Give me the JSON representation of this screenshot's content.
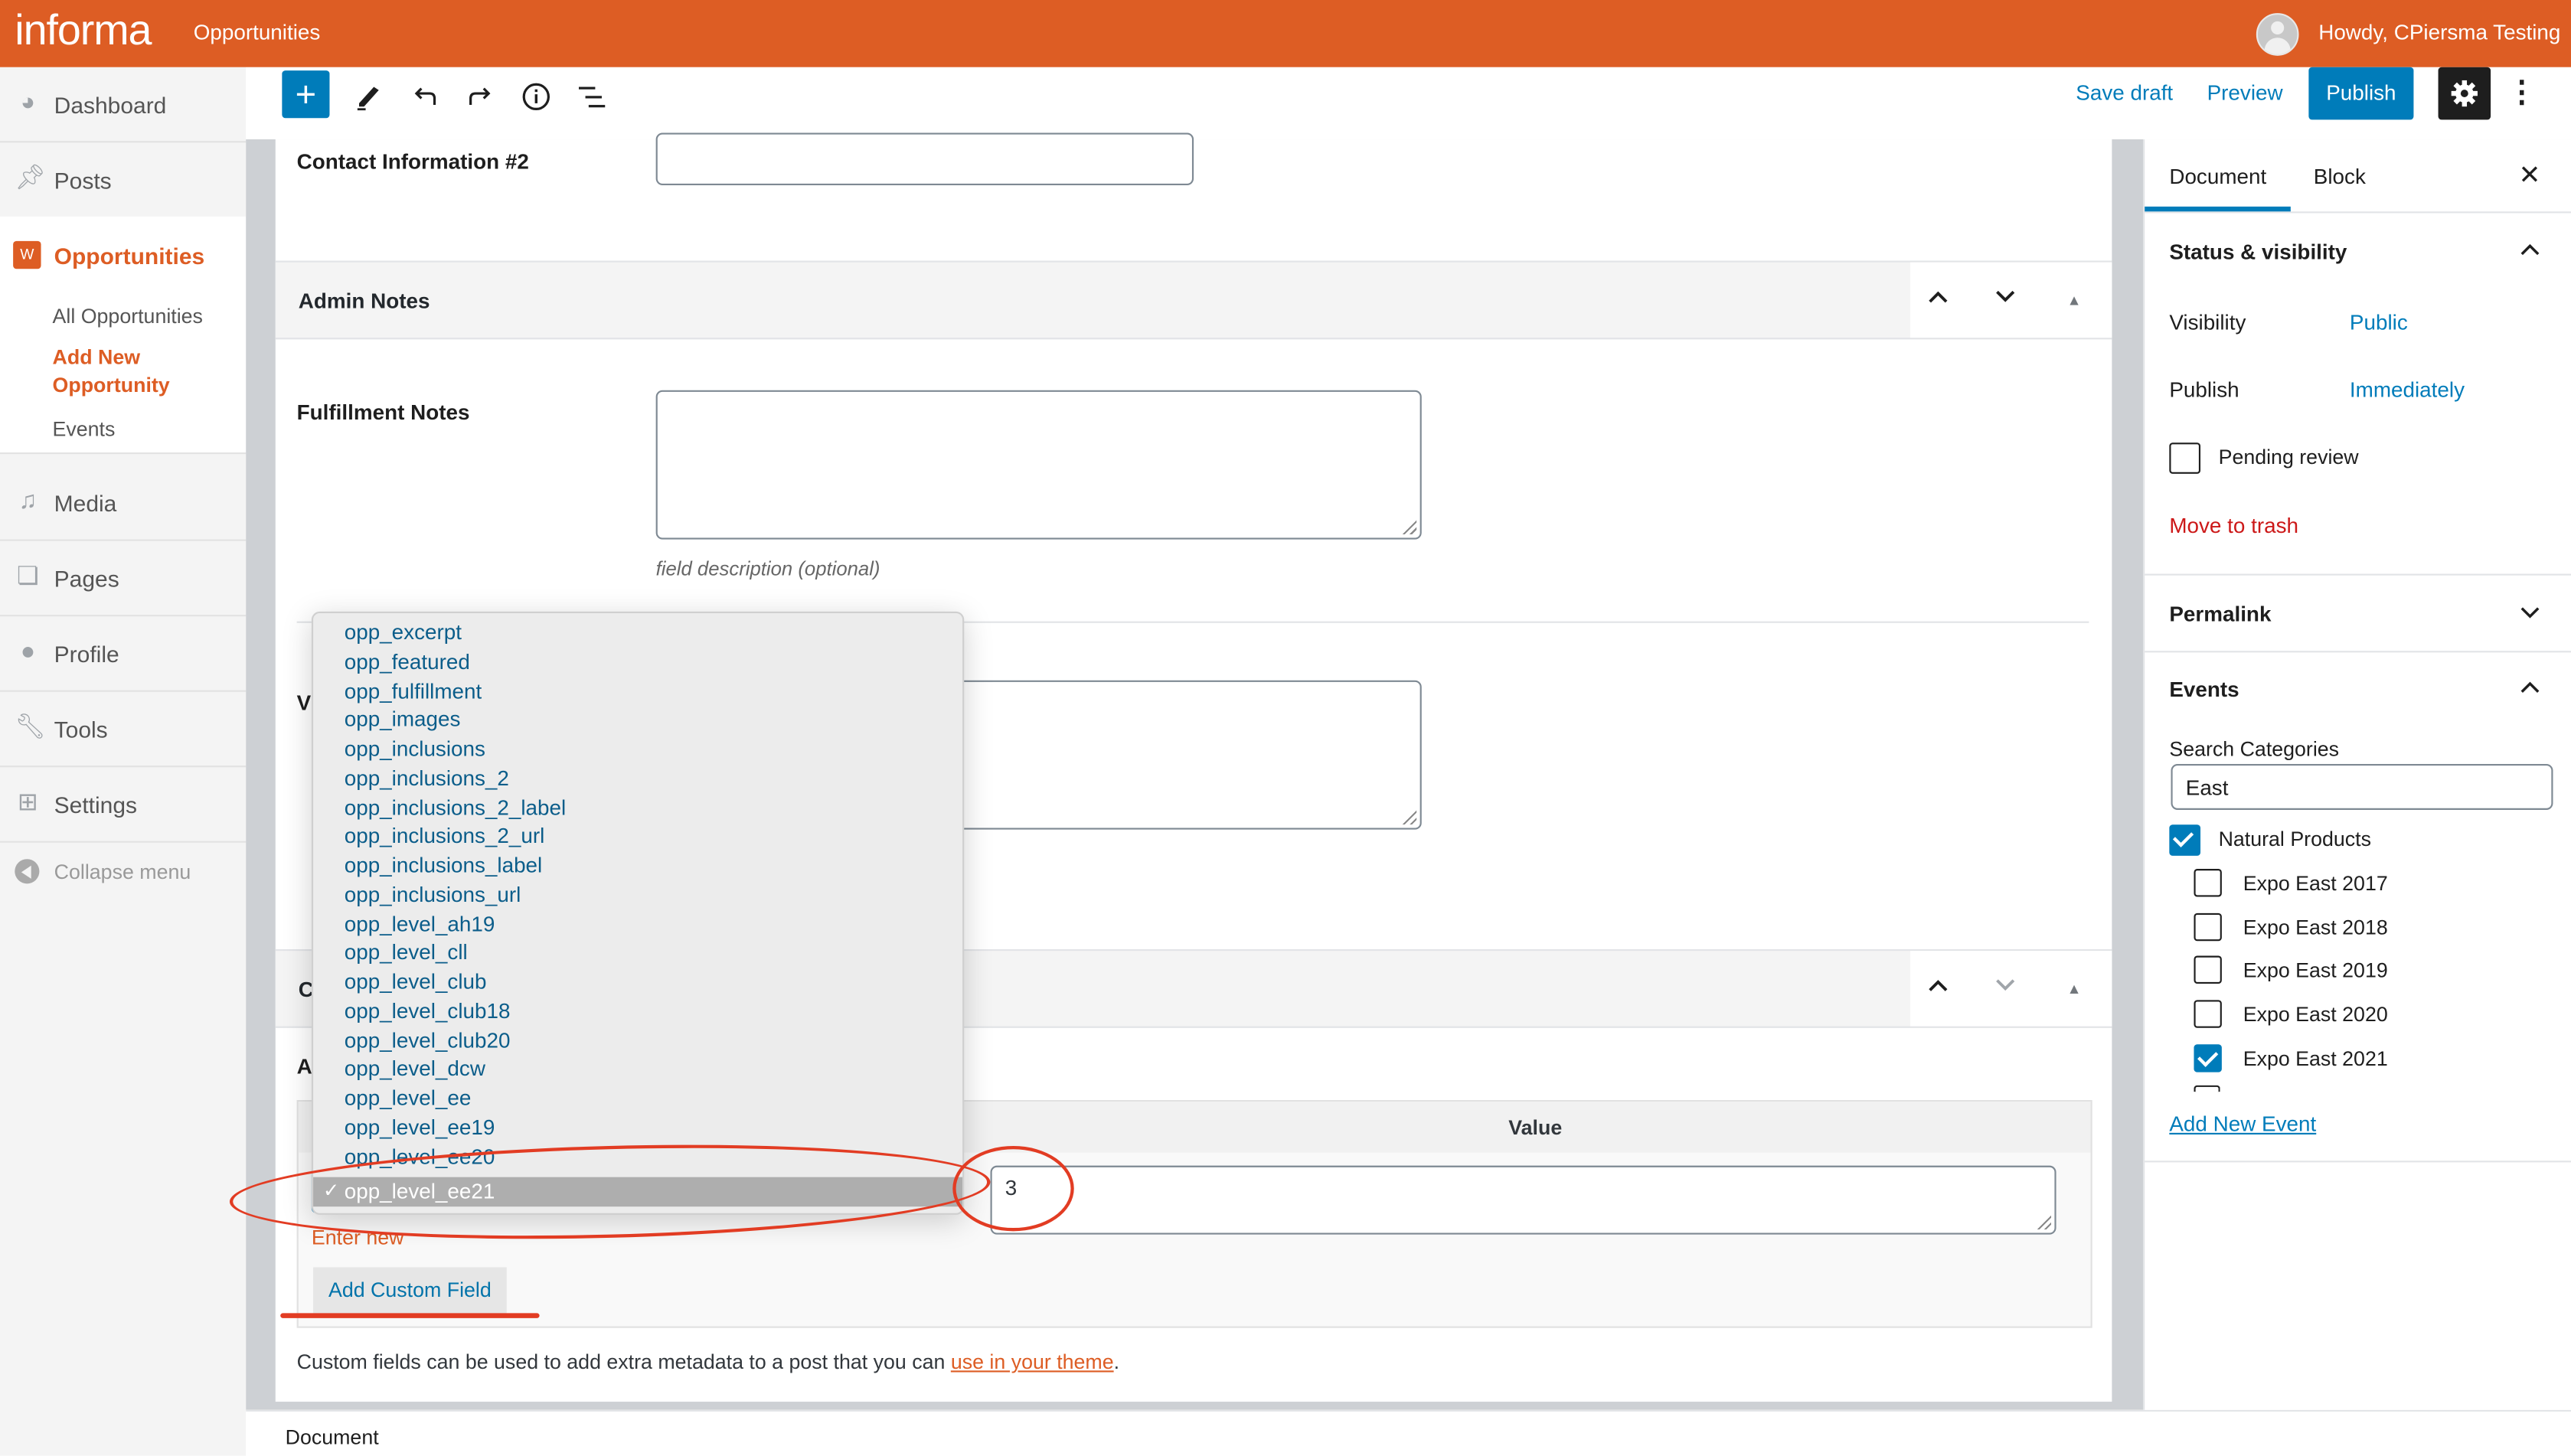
{
  "adminbar": {
    "logo": "informa",
    "site_name": "Opportunities",
    "greeting": "Howdy, CPiersma Testing"
  },
  "sidebar": {
    "items": [
      {
        "label": "Dashboard",
        "icon": "dashboard-icon"
      },
      {
        "label": "Posts",
        "icon": "pin-icon"
      },
      {
        "label": "Opportunities",
        "icon": "tickets-icon",
        "active": true,
        "submenu": [
          {
            "label": "All Opportunities",
            "active": false
          },
          {
            "label": "Add New Opportunity",
            "active": true
          },
          {
            "label": "Events",
            "active": false
          }
        ]
      },
      {
        "label": "Media",
        "icon": "media-icon"
      },
      {
        "label": "Pages",
        "icon": "pages-icon"
      },
      {
        "label": "Profile",
        "icon": "user-icon"
      },
      {
        "label": "Tools",
        "icon": "wrench-icon"
      },
      {
        "label": "Settings",
        "icon": "settings-sliders-icon"
      }
    ],
    "collapse_label": "Collapse menu"
  },
  "toolbar": {
    "tools": [
      "add-block",
      "edit-tools",
      "undo",
      "redo",
      "details-info",
      "block-navigation"
    ],
    "save_draft": "Save draft",
    "preview": "Preview",
    "publish": "Publish"
  },
  "editor": {
    "contact_info_2_label": "Contact Information #2",
    "contact_info_2_value": "",
    "admin_notes_title": "Admin Notes",
    "fulfillment_notes_label": "Fulfillment Notes",
    "fulfillment_notes_value": "",
    "field_description": "field description (optional)",
    "partial_label_v": "V",
    "partial_panel_c": "C",
    "partial_label_a": "A"
  },
  "custom_fields": {
    "value_header": "Value",
    "value": "3",
    "enter_new": "Enter new",
    "add_button": "Add Custom Field",
    "help_prefix": "Custom fields can be used to add extra metadata to a post that you can ",
    "help_link": "use in your theme",
    "help_suffix": "."
  },
  "dropdown": {
    "selected": "opp_level_ee21",
    "check_glyph": "✓",
    "options": [
      "opp_excerpt",
      "opp_featured",
      "opp_fulfillment",
      "opp_images",
      "opp_inclusions",
      "opp_inclusions_2",
      "opp_inclusions_2_label",
      "opp_inclusions_2_url",
      "opp_inclusions_label",
      "opp_inclusions_url",
      "opp_level_ah19",
      "opp_level_cll",
      "opp_level_club",
      "opp_level_club18",
      "opp_level_club20",
      "opp_level_dcw",
      "opp_level_ee",
      "opp_level_ee19",
      "opp_level_ee20",
      "opp_level_ee21"
    ]
  },
  "settings_panel": {
    "tabs": [
      {
        "label": "Document",
        "active": true
      },
      {
        "label": "Block",
        "active": false
      }
    ],
    "status_title": "Status & visibility",
    "visibility_label": "Visibility",
    "visibility_value": "Public",
    "publish_label": "Publish",
    "publish_value": "Immediately",
    "pending_review": "Pending review",
    "pending_review_checked": false,
    "move_to_trash": "Move to trash",
    "permalink_title": "Permalink",
    "events_title": "Events",
    "search_label": "Search Categories",
    "search_value": "East",
    "categories": [
      {
        "label": "Natural Products",
        "checked": true,
        "level": 0
      },
      {
        "label": "Expo East 2017",
        "checked": false,
        "level": 1
      },
      {
        "label": "Expo East 2018",
        "checked": false,
        "level": 1
      },
      {
        "label": "Expo East 2019",
        "checked": false,
        "level": 1
      },
      {
        "label": "Expo East 2020",
        "checked": false,
        "level": 1
      },
      {
        "label": "Expo East 2021",
        "checked": true,
        "level": 1
      }
    ],
    "add_new_event": "Add New Event"
  },
  "footer": {
    "breadcrumb": "Document"
  },
  "colors": {
    "brand_orange": "#dd5d24",
    "wp_blue": "#007cba",
    "trash_red": "#cc1818",
    "annotation_red": "#e23c23"
  }
}
